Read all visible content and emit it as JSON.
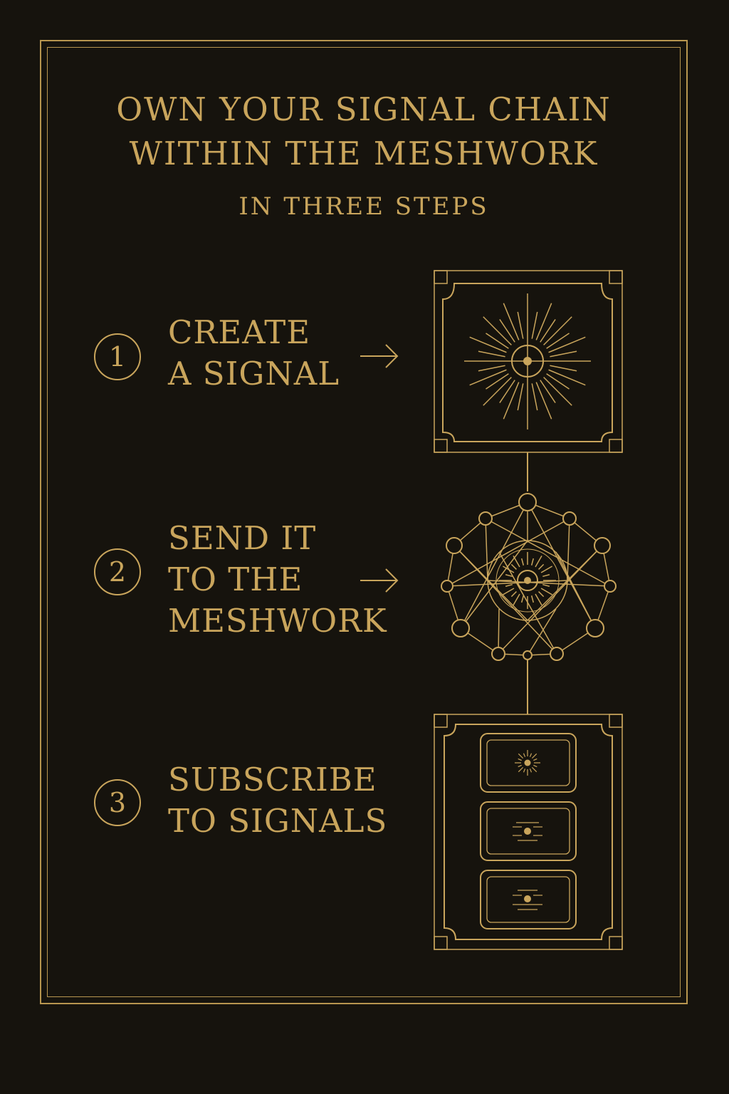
{
  "title": {
    "line1": "OWN YOUR SIGNAL CHAIN",
    "line2": "WITHIN THE MESHWORK",
    "subtitle": "IN THREE STEPS"
  },
  "steps": [
    {
      "number": "1",
      "lines": [
        "CREATE",
        "A SIGNAL"
      ],
      "icon": "radiant-signal-icon"
    },
    {
      "number": "2",
      "lines": [
        "SEND IT",
        "TO THE",
        "MESHWORK"
      ],
      "icon": "mesh-network-icon"
    },
    {
      "number": "3",
      "lines": [
        "SUBSCRIBE",
        "TO SIGNALS"
      ],
      "icon": "subscription-cards-icon"
    }
  ],
  "colors": {
    "background": "#16130d",
    "gold": "#c9a55c"
  }
}
